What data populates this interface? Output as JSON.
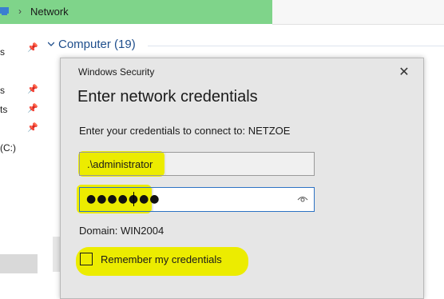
{
  "explorer": {
    "breadcrumb_separator": "›",
    "location": "Network",
    "group_header": "Computer (19)",
    "nav_items": [
      "s",
      "s",
      "ts",
      "(C:)"
    ]
  },
  "dialog": {
    "caption": "Windows Security",
    "close_glyph": "✕",
    "title": "Enter network credentials",
    "prompt": "Enter your credentials to connect to: NETZOE",
    "username_value": ".\\administrator",
    "password_mask": "●●●●●●●",
    "domain": "Domain: WIN2004",
    "remember_label": "Remember my credentials",
    "remember_checked": false
  },
  "colors": {
    "highlight": "#ecec00",
    "address_bar": "#7fd48a",
    "dialog_bg": "#e6e6e6",
    "focus_border": "#2d72c4",
    "group_header": "#1e4e8c"
  },
  "icons": {
    "address": "network-icon",
    "pin": "pin-icon",
    "chevron": "chevron-down-icon",
    "close": "close-icon",
    "reveal": "eye-icon"
  }
}
